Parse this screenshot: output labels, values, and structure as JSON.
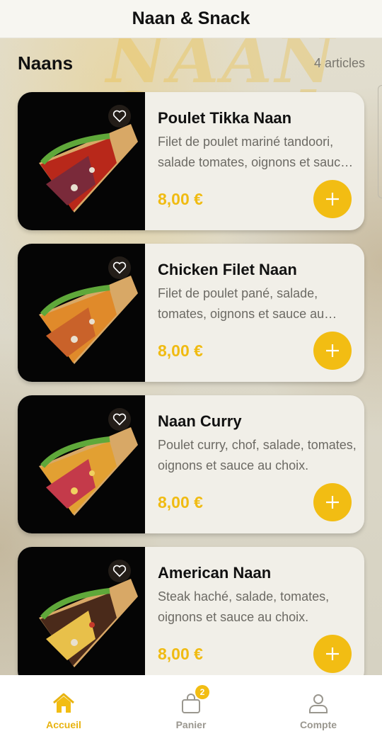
{
  "header": {
    "title": "Naan & Snack"
  },
  "section": {
    "title": "Naans",
    "count": "4 articles"
  },
  "products": [
    {
      "name": "Poulet Tikka Naan",
      "description": "Filet de poulet mariné tandoori, salade tomates, oignons et sauce au choix.",
      "price": "8,00 €",
      "filling": "#b8281a",
      "filling2": "#7a2a3a"
    },
    {
      "name": "Chicken Filet Naan",
      "description": "Filet de poulet pané, salade, tomates, oignons et sauce au choix.",
      "price": "8,00 €",
      "filling": "#e08a2a",
      "filling2": "#c9622a"
    },
    {
      "name": "Naan Curry",
      "description": "Poulet curry, chof, salade, tomates, oignons et sauce au choix.",
      "price": "8,00 €",
      "filling": "#e2a032",
      "filling2": "#c43a4a"
    },
    {
      "name": "American Naan",
      "description": "Steak haché, salade, tomates, oignons et sauce au choix.",
      "price": "8,00 €",
      "filling": "#4a2a1a",
      "filling2": "#e8c04a"
    }
  ],
  "nav": {
    "items": [
      {
        "label": "Accueil",
        "icon": "home-icon",
        "active": true
      },
      {
        "label": "Panier",
        "icon": "bag-icon",
        "badge": "2"
      },
      {
        "label": "Compte",
        "icon": "user-icon"
      }
    ]
  },
  "colors": {
    "accent": "#f2bd13",
    "price": "#f0bb12",
    "card": "#f1efe8"
  }
}
